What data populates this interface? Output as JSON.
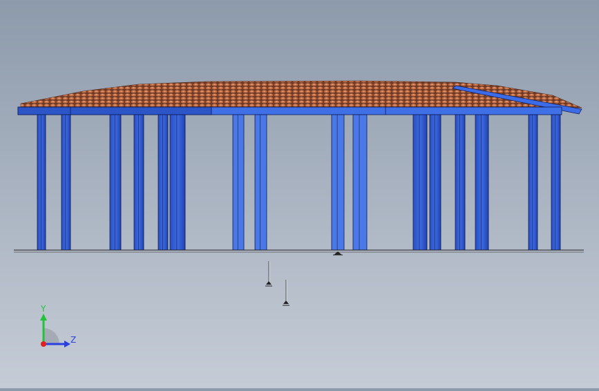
{
  "viewport": {
    "colors": {
      "background_top": "#8c9aab",
      "background_bottom": "#c5ccd6",
      "roof_tile": "#b3603a",
      "roof_shadow": "#5a2f1f",
      "beam_blue": "#3f6fe0",
      "beam_dark": "#1d3da8",
      "beam_edge": "#0d1a55",
      "ground_line": "#222222"
    }
  },
  "triad": {
    "y_label": "Y",
    "z_label": "Z",
    "y_color": "#23c23a",
    "z_color": "#2a3fe0",
    "x_color": "#e02020"
  }
}
